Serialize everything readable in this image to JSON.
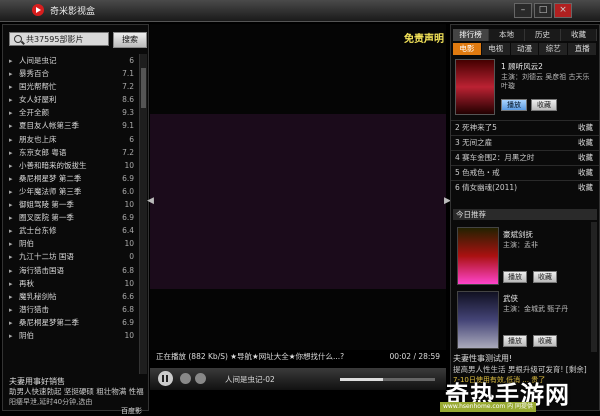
{
  "window": {
    "title": "奇米影视盒",
    "buttons": [
      "–",
      "□",
      "×"
    ]
  },
  "search": {
    "placeholder": "共37595部影片",
    "button": "搜索"
  },
  "movie_list": [
    {
      "title": "人间是虫记",
      "rating": "6"
    },
    {
      "title": "暴秀百合",
      "rating": "7.1"
    },
    {
      "title": "国光帮帮忙",
      "rating": "7.2"
    },
    {
      "title": "女人好屋利",
      "rating": "8.6"
    },
    {
      "title": "全开全颜",
      "rating": "9.3"
    },
    {
      "title": "夏目友人帐第三季",
      "rating": "9.1"
    },
    {
      "title": "朋友也上床",
      "rating": "6"
    },
    {
      "title": "东京女郎 粤语",
      "rating": "7.2"
    },
    {
      "title": "小善和暗来的饭拔生",
      "rating": "10"
    },
    {
      "title": "桑尼桐星梦 第二季",
      "rating": "6.9"
    },
    {
      "title": "少年魔法师 第三季",
      "rating": "6.0"
    },
    {
      "title": "御姐驾陵 第一季",
      "rating": "10"
    },
    {
      "title": "圈叉医院 第一季",
      "rating": "6.9"
    },
    {
      "title": "武士台东修",
      "rating": "6.4"
    },
    {
      "title": "阴伯",
      "rating": "10"
    },
    {
      "title": "九江十二坊 国语",
      "rating": "0"
    },
    {
      "title": "海行猎击国语",
      "rating": "6.8"
    },
    {
      "title": "再秋",
      "rating": "10"
    },
    {
      "title": "魔乳秘剑帖",
      "rating": "6.6"
    },
    {
      "title": "潜行猎击",
      "rating": "6.8"
    },
    {
      "title": "桑尼桐星梦第二季",
      "rating": "6.9"
    },
    {
      "title": "阴伯",
      "rating": "10"
    }
  ],
  "left_footer": {
    "line1": "夫妻用事好销售",
    "line2": "助男人快速勃起 坚挺硬硕 粗壮物满 性福",
    "line3": "阳痿早泄,延时40分钟,选由"
  },
  "baidu_label": "百度影",
  "player": {
    "disclaimer": "免责声明",
    "status": "正在播放 (882 Kb/S) ★导航★网址大全★你想找什么...?",
    "time": "00:02 / 28:59",
    "now_playing": "人间是虫记-02",
    "volume": 0.45
  },
  "right_tabs": [
    "排行榜",
    "本地",
    "历史",
    "收藏"
  ],
  "category_tabs": [
    "电影",
    "电视",
    "动漫",
    "综艺",
    "直播"
  ],
  "feature": {
    "title": "1 顾听风云2",
    "cast": "主演：刘德云 吴彦祖 古天乐 叶璇",
    "play": "播放",
    "fav": "收藏"
  },
  "rank_items": [
    {
      "title": "2 死神来了5",
      "fav": "收藏"
    },
    {
      "title": "3 无间之雇",
      "fav": "收藏"
    },
    {
      "title": "4 赛车金围2：月黑之时",
      "fav": "收藏"
    },
    {
      "title": "5 色戒色・戒",
      "fav": "收藏"
    },
    {
      "title": "6 倩女幽魂(2011)",
      "fav": "收藏"
    }
  ],
  "today_label": "今日推荐",
  "today_items": [
    {
      "title": "豪斌剑抚",
      "cast": "主演：孟非",
      "play": "播放",
      "fav": "收藏"
    },
    {
      "title": "武侠",
      "cast": "主演：金城武 甄子丹",
      "play": "播放",
      "fav": "收藏"
    }
  ],
  "right_footer": {
    "line1": "夫妻性事测试用!",
    "line2": "提高男人性生活 男根升级可发育! [剩余]",
    "line3": "7-10日使用有效,低消 ... 贵了"
  },
  "watermark": {
    "text": "奇热手游网",
    "url": "www.hsenhome.com 内 同提供"
  }
}
